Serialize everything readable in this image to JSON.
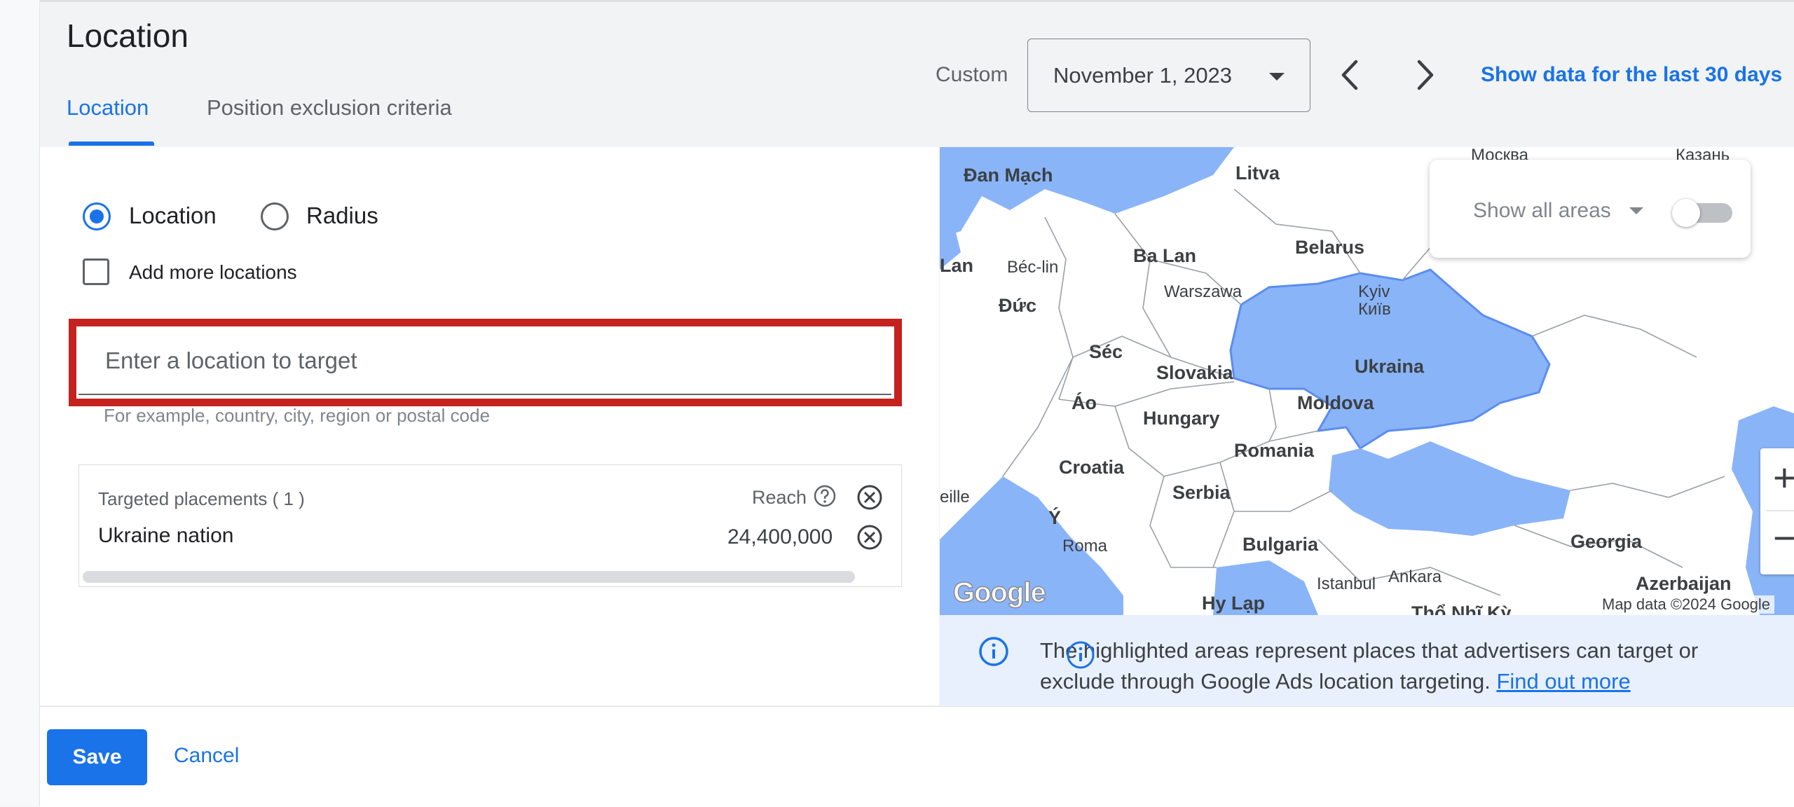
{
  "page": {
    "title": "Location",
    "tabs": [
      {
        "label": "Location",
        "active": true
      },
      {
        "label": "Position exclusion criteria",
        "active": false
      }
    ]
  },
  "date_range": {
    "custom_label": "Custom",
    "selected": "November 1, 2023",
    "last_30_link": "Show data for the last 30 days"
  },
  "targeting": {
    "radio_options": [
      {
        "label": "Location",
        "selected": true
      },
      {
        "label": "Radius",
        "selected": false
      }
    ],
    "add_more_label": "Add more locations",
    "search_placeholder": "Enter a location to target",
    "search_helper": "For example, country, city, region or postal code"
  },
  "placements": {
    "header": "Targeted placements ( 1 )",
    "reach_label": "Reach",
    "rows": [
      {
        "name": "Ukraine nation",
        "reach": "24,400,000"
      }
    ]
  },
  "map": {
    "show_areas_label": "Show all areas",
    "show_areas_enabled": false,
    "attribution": "Map data ©2024 Google",
    "logo": "Google",
    "zoom_in": "+",
    "zoom_out": "−",
    "labels": {
      "moskva": "Москва",
      "kazan": "Казань",
      "denmark": "Đan Mạch",
      "lithuania": "Litva",
      "lan": "Lan",
      "berlin": "Béc-lin",
      "poland": "Ba Lan",
      "belarus": "Belarus",
      "warsaw": "Warszawa",
      "kyiv": "Kyiv",
      "kyiv_cyr": "Київ",
      "germany": "Đức",
      "czech": "Séc",
      "slovakia": "Slovakia",
      "ukraine": "Ukraina",
      "austria": "Áo",
      "hungary": "Hungary",
      "moldova": "Moldova",
      "romania": "Romania",
      "croatia": "Croatia",
      "eille": "eille",
      "serbia": "Serbia",
      "italy": "Ý",
      "rome": "Roma",
      "bulgaria": "Bulgaria",
      "georgia": "Georgia",
      "istanbul": "Istanbul",
      "ankara": "Ankara",
      "azerbaijan": "Azerbaijan",
      "greece": "Hy Lạp",
      "turkey": "Thổ Nhĩ Kỳ"
    },
    "colors": {
      "water": "#8ab4f8",
      "land": "#ffffff",
      "highlight": "#8ab4f8",
      "border": "#9aa0a6"
    }
  },
  "info": {
    "text": "The highlighted areas represent places that advertisers can target or exclude through Google Ads location targeting.",
    "link": "Find out more"
  },
  "actions": {
    "save": "Save",
    "cancel": "Cancel"
  }
}
